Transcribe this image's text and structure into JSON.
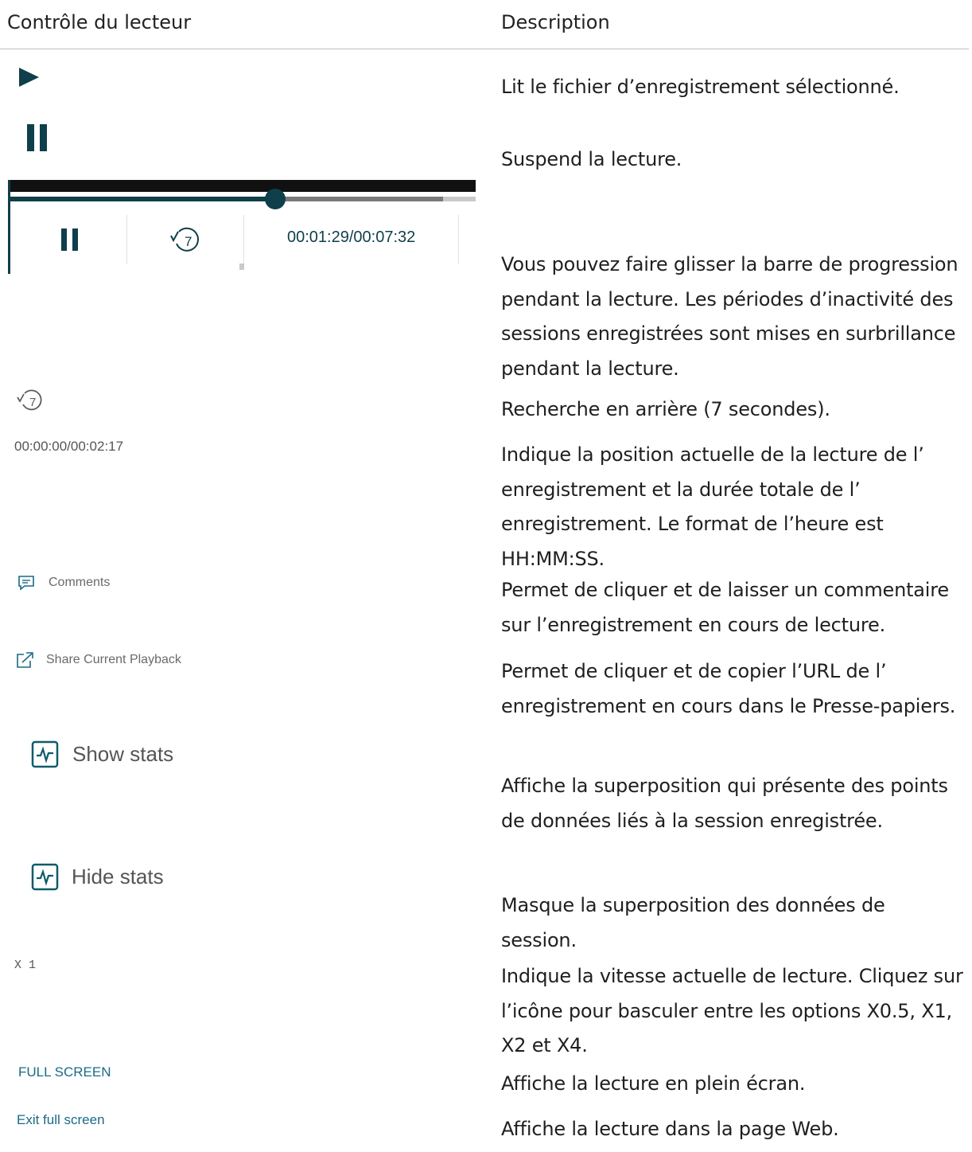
{
  "headers": {
    "control": "Contrôle du lecteur",
    "description": "Description"
  },
  "colors": {
    "player_dark": "#0f3f4a",
    "teal": "#0f5b6b",
    "link_blue": "#1b6a86"
  },
  "rows": {
    "play": {
      "icon": "play-icon",
      "desc": "Lit le fichier d’enregistrement sélectionné."
    },
    "pause": {
      "icon": "pause-icon",
      "desc": "Suspend la lecture."
    },
    "progress": {
      "time": "00:01:29/00:07:32",
      "progress_fraction": 0.57,
      "buffered_fraction": 0.93,
      "desc_lines": [
        "Vous pouvez faire glisser la barre de progression",
        "pendant la lecture. Les périodes d’inactivité des",
        "sessions enregistrées sont mises en surbrillance",
        "pendant la lecture."
      ]
    },
    "seek_back": {
      "icon": "rewind-7-icon",
      "icon_text": "7",
      "desc": "Recherche en arrière (7 secondes)."
    },
    "time_display": {
      "value": "00:00:00/00:02:17",
      "desc_lines": [
        "Indique la position actuelle de la lecture de l’",
        "enregistrement et la durée totale de l’",
        "enregistrement. Le format de l’heure est",
        "HH:MM:SS."
      ]
    },
    "comments": {
      "label": "Comments",
      "desc_lines": [
        "Permet de cliquer et de laisser un commentaire",
        "sur l’enregistrement en cours de lecture."
      ]
    },
    "share": {
      "label": "Share Current Playback",
      "desc_lines": [
        "Permet de cliquer et de copier l’URL de l’",
        "enregistrement en cours dans le Presse-papiers."
      ]
    },
    "show_stats": {
      "label": "Show stats",
      "desc_lines": [
        "Affiche la superposition qui présente des points",
        "de données liés à la session enregistrée."
      ]
    },
    "hide_stats": {
      "label": "Hide stats",
      "desc_lines": [
        "Masque la superposition des données de",
        "session."
      ]
    },
    "speed": {
      "label": "X 1",
      "desc_lines": [
        "Indique la vitesse actuelle de lecture. Cliquez sur",
        "l’icône pour basculer entre les options X0.5, X1,",
        "X2 et X4."
      ]
    },
    "full_screen": {
      "label": "FULL SCREEN",
      "desc": "Affiche la lecture en plein écran."
    },
    "exit_full_screen": {
      "label": "Exit full screen",
      "desc": "Affiche la lecture dans la page Web."
    }
  }
}
